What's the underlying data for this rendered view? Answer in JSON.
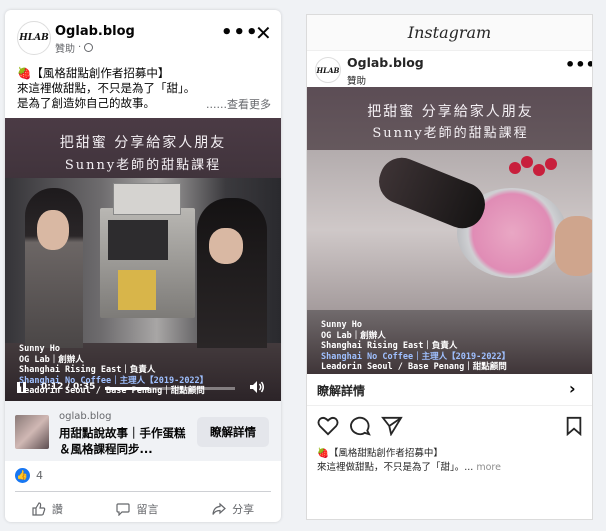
{
  "facebook": {
    "page_name": "Oglab.blog",
    "logo_text": "HLAB",
    "sponsored": "贊助",
    "sponsored_dot": "·",
    "more_icon": "more-horizontal-icon",
    "close_icon": "close-icon",
    "post_text": {
      "line1": "🍓【風格甜點創作者招募中】",
      "line2": "來這裡做甜點，不只是為了「甜」。",
      "line3": "是為了創造妳自己的故事。",
      "see_more": "......查看更多"
    },
    "video": {
      "title1": "把甜蜜 分享給家人朋友",
      "title2": "Sunny老師的甜點課程",
      "credits": [
        "Sunny Ho",
        "OG Lab｜創辦人",
        "Shanghai Rising East｜負責人",
        "Shanghai No Coffee｜主理人【2019-2022】",
        "Leadorin Seoul / Base Penang｜甜點顧問"
      ],
      "time": "0:12 / 0:35",
      "progress": 0.34
    },
    "cta": {
      "site": "oglab.blog",
      "title": "用甜點說故事｜手作蛋糕＆風格課程同步...",
      "button": "瞭解詳情"
    },
    "reactions": {
      "count": "4",
      "icon": "like-icon"
    },
    "actions": {
      "like": "讚",
      "comment": "留言",
      "share": "分享"
    }
  },
  "instagram": {
    "header": "Instagram",
    "page_name": "Oglab.blog",
    "sponsored": "贊助",
    "more_icon": "more-horizontal-icon",
    "video": {
      "title1": "把甜蜜 分享給家人朋友",
      "title2": "Sunny老師的甜點課程",
      "credits": [
        "Sunny Ho",
        "OG Lab｜創辦人",
        "Shanghai Rising East｜負責人",
        "Shanghai No Coffee｜主理人【2019-2022】",
        "Leadorin Seoul / Base Penang｜甜點顧問"
      ]
    },
    "cta": {
      "label": "瞭解詳情",
      "icon": "chevron-right-icon"
    },
    "caption": {
      "line1": "🍓【風格甜點創作者招募中】",
      "line2": "來這裡做甜點，不只是為了「甜」。...",
      "more": "more"
    }
  },
  "colors": {
    "fb_blue": "#1877f2",
    "fb_gray_bg": "#f0f2f5",
    "ig_border": "#dbdbdb"
  }
}
